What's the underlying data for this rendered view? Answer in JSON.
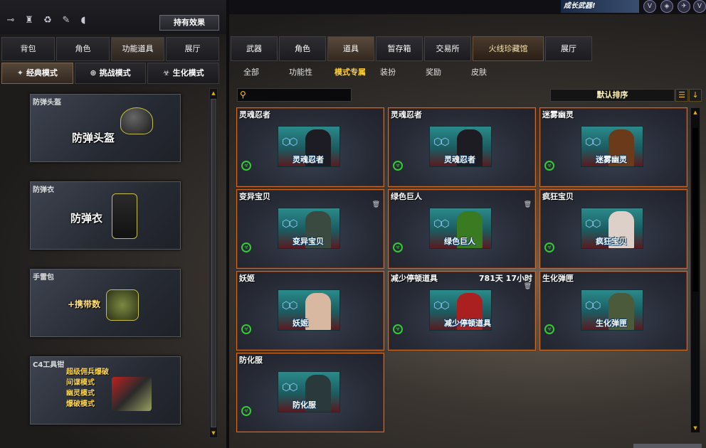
{
  "toolbar": {
    "icons": [
      "key-icon",
      "trophy-icon",
      "recycle-icon",
      "paintbrush-icon",
      "mouse-icon"
    ],
    "effects_label": "持有效果"
  },
  "left_tabs": [
    {
      "label": "背包",
      "active": false
    },
    {
      "label": "角色",
      "active": false
    },
    {
      "label": "功能道具",
      "active": true
    },
    {
      "label": "展厅",
      "active": false
    }
  ],
  "mode_tabs": [
    {
      "label": "经典模式",
      "icon": "crosshair-icon",
      "active": true
    },
    {
      "label": "挑战模式",
      "icon": "target-icon",
      "active": false
    },
    {
      "label": "生化模式",
      "icon": "biohazard-icon",
      "active": false
    }
  ],
  "left_items": [
    {
      "name": "防弹头盔",
      "big": "防弹头盔"
    },
    {
      "name": "防弹衣",
      "big": "防弹衣"
    },
    {
      "name": "手雷包",
      "big": "+携带数"
    },
    {
      "name": "C4工具钳",
      "lines": [
        "超级佣兵爆破",
        "间谍模式",
        "幽灵模式",
        "爆破模式"
      ]
    }
  ],
  "banner": {
    "ad_text": "成长武器!"
  },
  "main_tabs": [
    {
      "label": "武器",
      "active": false
    },
    {
      "label": "角色",
      "active": false
    },
    {
      "label": "道具",
      "active": true
    },
    {
      "label": "暂存箱",
      "active": false
    },
    {
      "label": "交易所",
      "active": false
    },
    {
      "label": "火线珍藏馆",
      "active": false,
      "wide": true
    },
    {
      "label": "展厅",
      "active": false
    }
  ],
  "sub_tabs": [
    {
      "label": "全部",
      "active": false
    },
    {
      "label": "功能性",
      "active": false
    },
    {
      "label": "模式专属",
      "active": true
    },
    {
      "label": "装扮",
      "active": false
    },
    {
      "label": "奖励",
      "active": false
    },
    {
      "label": "皮肤",
      "active": false
    }
  ],
  "search": {
    "placeholder": ""
  },
  "sort": {
    "label": "默认排序"
  },
  "colors": {
    "accent": "#ffcf3a",
    "card_border": "#d06a20",
    "green_icon": "#33cc33"
  },
  "items": [
    {
      "name": "灵魂忍者",
      "label": "灵魂忍者",
      "time": "",
      "trash": false,
      "fig": "#1c1c22"
    },
    {
      "name": "灵魂忍者",
      "label": "灵魂忍者",
      "time": "",
      "trash": false,
      "fig": "#1c1c22"
    },
    {
      "name": "迷雾幽灵",
      "label": "迷雾幽灵",
      "time": "",
      "trash": false,
      "fig": "#6a3a1a"
    },
    {
      "name": "变异宝贝",
      "label": "变异宝贝",
      "time": "",
      "trash": true,
      "fig": "#3a4a40"
    },
    {
      "name": "绿色巨人",
      "label": "绿色巨人",
      "time": "",
      "trash": true,
      "fig": "#3a7a20"
    },
    {
      "name": "疯狂宝贝",
      "label": "疯狂宝贝",
      "time": "",
      "trash": false,
      "fig": "#ddd0c8"
    },
    {
      "name": "妖姬",
      "label": "妖姬",
      "time": "",
      "trash": false,
      "fig": "#d8b8a0"
    },
    {
      "name": "减少停顿道具",
      "label": "减少停顿道具",
      "time": "781天 17小时",
      "trash": true,
      "fig": "#aa2020"
    },
    {
      "name": "生化弹匣",
      "label": "生化弹匣",
      "time": "",
      "trash": false,
      "fig": "#4a5a3a"
    },
    {
      "name": "防化服",
      "label": "防化服",
      "time": "",
      "trash": false,
      "fig": "#2a3a3a"
    }
  ]
}
